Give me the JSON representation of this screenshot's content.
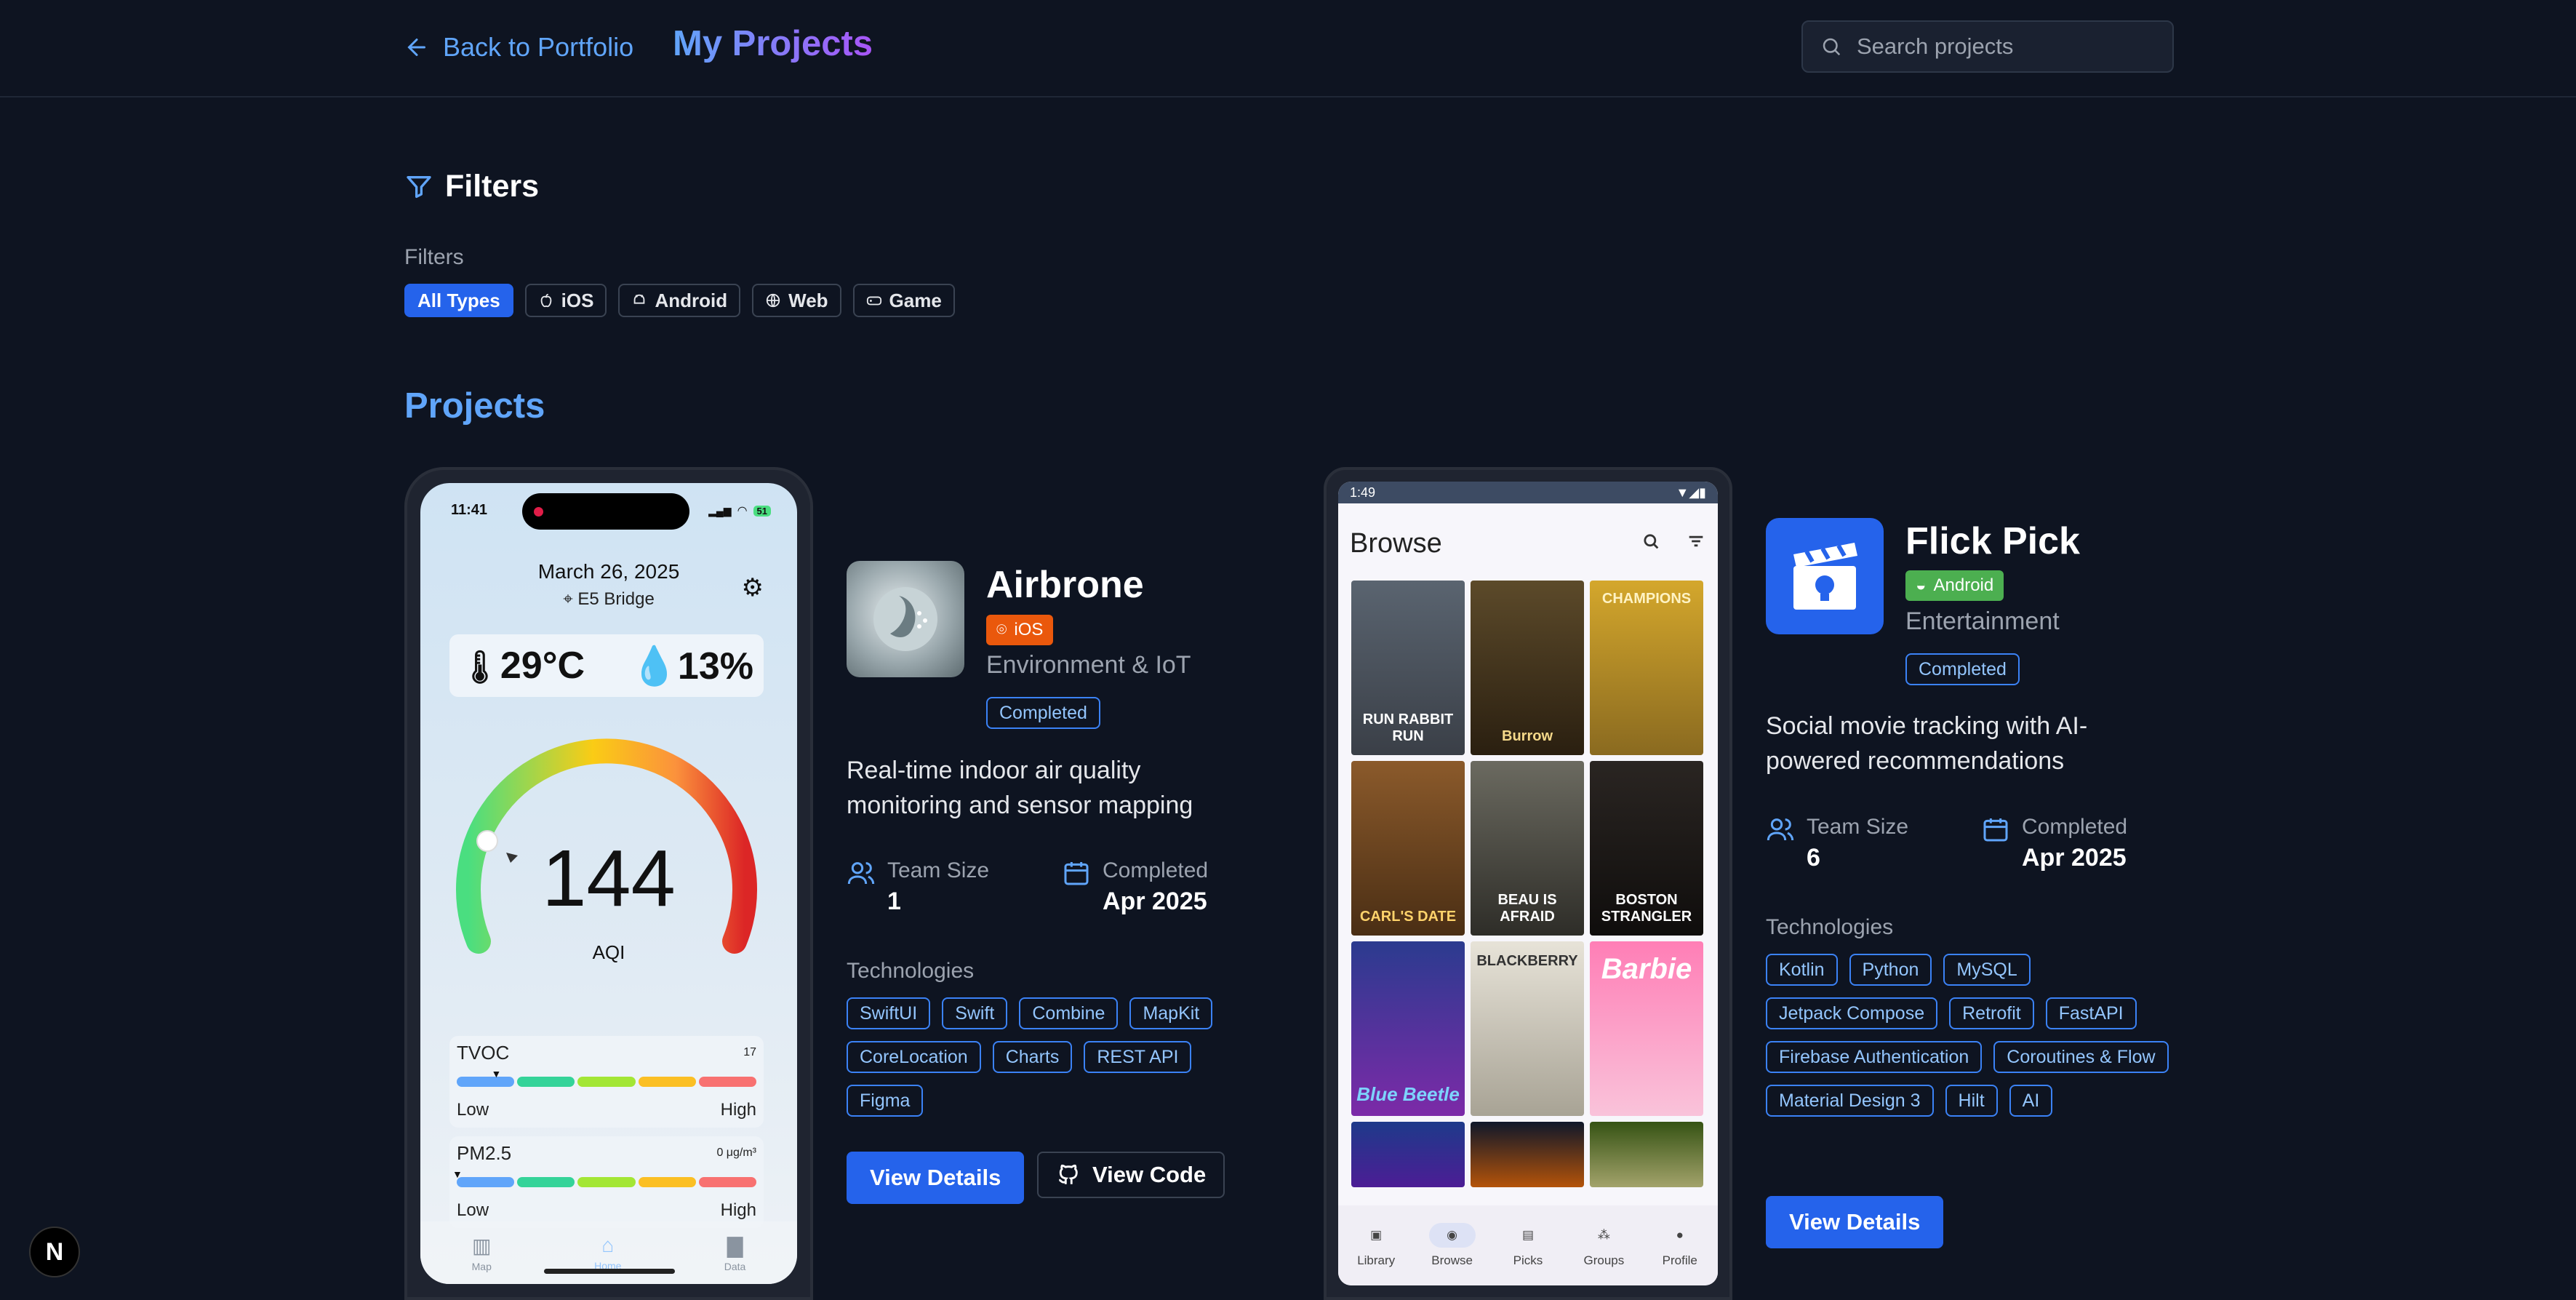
{
  "header": {
    "back_label": "Back to Portfolio",
    "title": "My Projects",
    "search_placeholder": "Search projects"
  },
  "filters": {
    "heading": "Filters",
    "label": "Filters",
    "chips": [
      "All Types",
      "iOS",
      "Android",
      "Web",
      "Game"
    ],
    "active": "All Types"
  },
  "projects_title": "Projects",
  "projects": [
    {
      "name": "Airbrone",
      "platform": "iOS",
      "platform_color": "#ea580c",
      "category": "Environment & IoT",
      "status": "Completed",
      "description_line1": "Real-time indoor air quality",
      "description_line2": "monitoring and sensor mapping",
      "team_size_label": "Team Size",
      "team_size": "1",
      "completed_label": "Completed",
      "completed": "Apr 2025",
      "tech_label": "Technologies",
      "technologies": [
        "SwiftUI",
        "Swift",
        "Combine",
        "MapKit",
        "CoreLocation",
        "Charts",
        "REST API",
        "Figma"
      ],
      "details_button": "View Details",
      "code_button": "View Code",
      "screenshot": {
        "time": "11:41",
        "battery": "51",
        "date": "March 26, 2025",
        "location": "E5 Bridge",
        "temperature": "29°C",
        "humidity": "13%",
        "aqi_value": "144",
        "aqi_label": "AQI",
        "tvoc_name": "TVOC",
        "tvoc_value": "17",
        "tvoc_level": 0.13,
        "pm_name": "PM2.5",
        "pm_value": "0 μg/m³",
        "pm_level": 0.0,
        "low": "Low",
        "high": "High",
        "tabs": [
          "Map",
          "Home",
          "Data"
        ]
      }
    },
    {
      "name": "Flick Pick",
      "platform": "Android",
      "platform_color": "#4caf50",
      "category": "Entertainment",
      "status": "Completed",
      "description_line1": "Social movie tracking with AI-",
      "description_line2": "powered recommendations",
      "team_size_label": "Team Size",
      "team_size": "6",
      "completed_label": "Completed",
      "completed": "Apr 2025",
      "tech_label": "Technologies",
      "technologies": [
        "Kotlin",
        "Python",
        "MySQL",
        "Jetpack Compose",
        "Retrofit",
        "FastAPI",
        "Firebase Authentication",
        "Coroutines & Flow",
        "Material Design 3",
        "Hilt",
        "AI"
      ],
      "details_button": "View Details",
      "screenshot": {
        "time": "1:49",
        "title": "Browse",
        "posters": [
          "RUN RABBIT RUN",
          "Burrow",
          "CHAMPIONS",
          "CARL'S DATE",
          "BEAU IS AFRAID",
          "BOSTON STRANGLER",
          "Blue Beetle",
          "BLACKBERRY",
          "Barbie",
          "",
          "",
          ""
        ],
        "nav": [
          "Library",
          "Browse",
          "Picks",
          "Groups",
          "Profile"
        ],
        "selected_nav": "Browse"
      }
    }
  ],
  "colors": {
    "background": "#0e1421",
    "accent": "#2563eb",
    "link": "#60a5fa"
  },
  "badge_letter": "N"
}
